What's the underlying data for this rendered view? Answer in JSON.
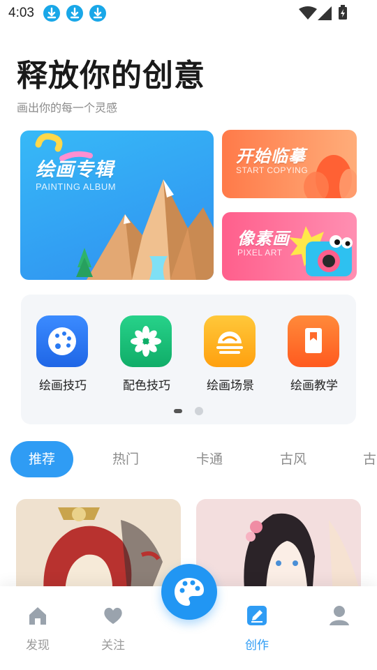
{
  "status_bar": {
    "time": "4:03",
    "icons": [
      "download-icon",
      "download-icon",
      "download-icon",
      "wifi-icon",
      "signal-icon",
      "battery-charging-icon"
    ]
  },
  "header": {
    "title": "释放你的创意",
    "subtitle": "画出你的每一个灵感"
  },
  "banners": {
    "album": {
      "title": "绘画专辑",
      "subtitle": "PAINTING ALBUM",
      "color": "#2f8ff0"
    },
    "copy": {
      "title": "开始临摹",
      "subtitle": "START COPYING",
      "color": "#ff7a49"
    },
    "pixel": {
      "title": "像素画",
      "subtitle": "PIXEL ART",
      "color": "#ff5f8c"
    }
  },
  "categories": [
    {
      "label": "绘画技巧",
      "icon": "palette-icon",
      "color": "#2a7af2"
    },
    {
      "label": "配色技巧",
      "icon": "flower-icon",
      "color": "#19c07a"
    },
    {
      "label": "绘画场景",
      "icon": "sunset-icon",
      "color": "#ffb21a"
    },
    {
      "label": "绘画教学",
      "icon": "book-icon",
      "color": "#ff6b2c"
    }
  ],
  "tabs": [
    {
      "label": "推荐",
      "active": true
    },
    {
      "label": "热门",
      "active": false
    },
    {
      "label": "卡通",
      "active": false
    },
    {
      "label": "古风",
      "active": false
    },
    {
      "label": "古",
      "active": false
    }
  ],
  "bottom_nav": [
    {
      "label": "发现",
      "icon": "home-icon",
      "active": false
    },
    {
      "label": "关注",
      "icon": "heart-icon",
      "active": false
    },
    {
      "label": "创作",
      "icon": "edit-icon",
      "active": true
    },
    {
      "label": "",
      "icon": "user-icon",
      "active": false
    }
  ],
  "theme": {
    "accent": "#2f9cf4",
    "fab": "#2196f3"
  }
}
